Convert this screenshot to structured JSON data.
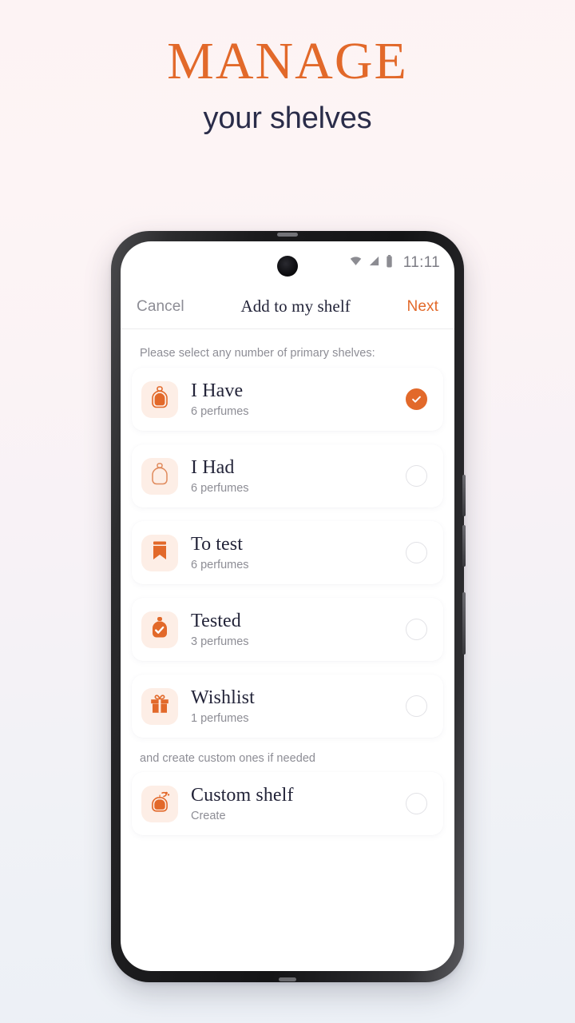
{
  "promo": {
    "title": "MANAGE",
    "subtitle": "your shelves",
    "title_color": "#e2692a",
    "subtitle_color": "#2a2c49"
  },
  "status_bar": {
    "time": "11:11",
    "icons": [
      "wifi-icon",
      "cellular-signal-icon",
      "battery-icon"
    ]
  },
  "nav": {
    "cancel_label": "Cancel",
    "title": "Add to my shelf",
    "next_label": "Next",
    "accent_color": "#e2692a"
  },
  "main": {
    "primary_label": "Please select any number of primary shelves:",
    "custom_label": "and create custom ones if needed",
    "primary_shelves": [
      {
        "title": "I Have",
        "subtitle": "6 perfumes",
        "icon": "perfume-bottle-filled-icon",
        "selected": true
      },
      {
        "title": "I Had",
        "subtitle": "6 perfumes",
        "icon": "perfume-bottle-outline-icon",
        "selected": false
      },
      {
        "title": "To test",
        "subtitle": "6 perfumes",
        "icon": "bookmark-icon",
        "selected": false
      },
      {
        "title": "Tested",
        "subtitle": "3 perfumes",
        "icon": "perfume-bottle-check-icon",
        "selected": false
      },
      {
        "title": "Wishlist",
        "subtitle": "1 perfumes",
        "icon": "gift-icon",
        "selected": false
      }
    ],
    "custom_shelves": [
      {
        "title": "Custom shelf",
        "subtitle": "Create",
        "icon": "perfume-atomizer-icon",
        "selected": false
      }
    ]
  },
  "theme": {
    "accent": "#e2692a",
    "icon_tile_bg": "#fdeee6",
    "text_dark": "#232439",
    "text_muted": "#8d8d95",
    "screen_bg": "#ffffff"
  }
}
